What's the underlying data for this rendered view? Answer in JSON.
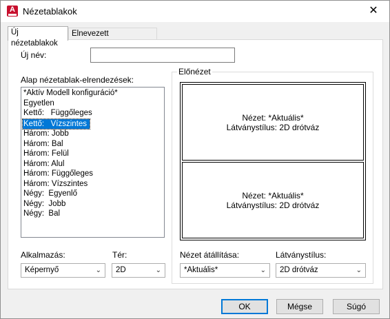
{
  "window": {
    "title": "Nézetablakok",
    "app_icon_letter": "A",
    "close_glyph": "✕"
  },
  "tabs": [
    {
      "label": "Új nézetablakok",
      "active": true
    },
    {
      "label": "Elnevezett nézetablakok",
      "active": false
    }
  ],
  "new_name": {
    "label": "Új név:",
    "value": ""
  },
  "layouts": {
    "label": "Alap nézetablak-elrendezések:",
    "items": [
      "*Aktív Modell konfiguráció*",
      "Egyetlen",
      "Kettő:   Függőleges",
      "Kettő:   Vízszintes",
      "Három: Jobb",
      "Három: Bal",
      "Három: Felül",
      "Három: Alul",
      "Három: Függőleges",
      "Három: Vízszintes",
      "Négy:  Egyenlő",
      "Négy:  Jobb",
      "Négy:  Bal"
    ],
    "selected_index": 3
  },
  "preview": {
    "label": "Előnézet",
    "viewports": [
      {
        "view_text": "Nézet: *Aktuális*",
        "style_text": "Látványstílus: 2D drótváz"
      },
      {
        "view_text": "Nézet: *Aktuális*",
        "style_text": "Látványstílus: 2D drótváz"
      }
    ]
  },
  "apply_to": {
    "label": "Alkalmazás:",
    "value": "Képernyő"
  },
  "space": {
    "label": "Tér:",
    "value": "2D"
  },
  "view_setting": {
    "label": "Nézet átállítása:",
    "value": "*Aktuális*"
  },
  "visual_style": {
    "label": "Látványstílus:",
    "value": "2D drótváz"
  },
  "buttons": {
    "ok": "OK",
    "cancel": "Mégse",
    "help": "Súgó"
  },
  "colors": {
    "selection": "#0078d7",
    "brand": "#c8102e"
  }
}
